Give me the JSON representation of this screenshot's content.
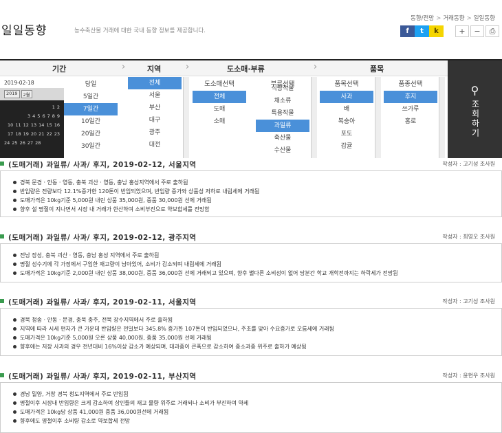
{
  "header": {
    "title": "일일동향",
    "subtitle": "농수축산물 거래에 대한 국내 동향 정보를 제공합니다.",
    "crumbs": [
      "동향/전망",
      "거래동향",
      "일일동향"
    ],
    "crumb_sep": ">",
    "share": [
      "f",
      "t",
      "k"
    ],
    "zoom": [
      "+",
      "−",
      "⎙"
    ]
  },
  "filter": {
    "heads": {
      "period": "기간",
      "region": "지역",
      "whole": "도소매·부류",
      "item": "품목"
    },
    "subheads": {
      "whole": "도소매선택",
      "cat": "부류선택",
      "item": "품목선택",
      "variety": "품종선택"
    },
    "cal": {
      "date": "2019-02-18",
      "year": "2019",
      "month": "2월",
      "rows": [
        [
          "1",
          "2"
        ],
        [
          "3",
          "4",
          "5",
          "6",
          "7",
          "8",
          "9"
        ],
        [
          "10",
          "11",
          "12",
          "13",
          "14",
          "15",
          "16"
        ],
        [
          "17",
          "18",
          "19",
          "20",
          "21",
          "22",
          "23"
        ],
        [
          "24",
          "25",
          "26",
          "27",
          "28"
        ]
      ]
    },
    "periods": [
      "당일",
      "5일간",
      "7일간",
      "10일간",
      "20일간",
      "30일간"
    ],
    "regions": [
      "전체",
      "서울",
      "부산",
      "대구",
      "광주",
      "대전"
    ],
    "wholes": [
      "전체",
      "도매",
      "소매"
    ],
    "cats": [
      "식량작물",
      "채소류",
      "특용작물",
      "과일류",
      "축산물",
      "수산물"
    ],
    "items": [
      "사과",
      "배",
      "복숭아",
      "포도",
      "감귤"
    ],
    "varieties": [
      "후지",
      "쓰가루",
      "홍로"
    ],
    "search": {
      "icon": "⚲",
      "label": "조회하기"
    }
  },
  "reports": [
    {
      "title": "(도매거래) 과일류/ 사과/ 후지, 2019-02-12, 서울지역",
      "author": "작성자 : 고기성 조사원",
      "lines": [
        "경북 문경 · 안동 · 영동, 충북 괴산 · 영동, 충남 홍성지역에서 주로 출하됨",
        "반입량은 전량보다 12.1%증가한 120톤이 반입되었으며, 반입량 증가와 상품성 저하로 내림세에 거래됨",
        "도매가격은 10kg기준 5,000원 내린 상품 35,000원, 중품 30,000원 선에 거래됨",
        "향후 설 명절이 지나면서 시장 내 거래가 한산하여 소비부진으로 약보합세를 전망함"
      ]
    },
    {
      "title": "(도매거래) 과일류/ 사과/ 후지, 2019-02-12, 광주지역",
      "author": "작성자 : 최영오 조사원",
      "lines": [
        "전남 장성, 충북 괴산 · 영동, 충남 홍성 지역에서 주로 출하됨",
        "명절 성수기에 각 가정에서 구입한 재고량이 남아있어, 소비가 감소되며 내림세에 거래됨",
        "도매가격은 10kg기준 2,000원 내린 상품 38,000원, 중품 36,000원 선에 거래되고 있으며, 향후 별다른 소비성이 없어 당분간 학교 개학전까지는 하락세가 전망됨"
      ]
    },
    {
      "title": "(도매거래) 과일류/ 사과/ 후지, 2019-02-11, 서울지역",
      "author": "작성자 : 고기성 조사원",
      "lines": [
        "경북 청송 · 안동 · 문경, 충북 충주, 전북 장수지역에서 주로 출하됨",
        "지역에 따라 시세 편차가 큰 가운데 반입량은 전일보다 345.8% 증가한 107톤이 반입되었으나, 주초를 맞아 수요증가로 오름세에 거래됨",
        "도매가격은 10kg기준 5,000원 오른 상품 40,000원, 중품 35,000원 선에 거래됨",
        "향후에는 저장 사과의 경우 전년대비 16%이상 감소가 예상되며, 대과중이 큰폭으로 감소하여 중소과중 위주로 출하가 예상됨"
      ]
    },
    {
      "title": "(도매거래) 과일류/ 사과/ 후지, 2019-02-11, 부산지역",
      "author": "작성자 : 윤현우 조사원",
      "lines": [
        "경남 밀양, 거창 경북 청도지역에서 주로 반입됨",
        "명절이후 시장내 반입량은 크게 감소하여 상인들의 재고 물량 위주로 거래되나 소비가 부진하여 약세",
        "도매가격은 10kg당 상품 41,000원 중품 36,000원선에 거래됨",
        "향후에도 명절이후 소비량 감소로 약보합세 전망"
      ]
    }
  ]
}
